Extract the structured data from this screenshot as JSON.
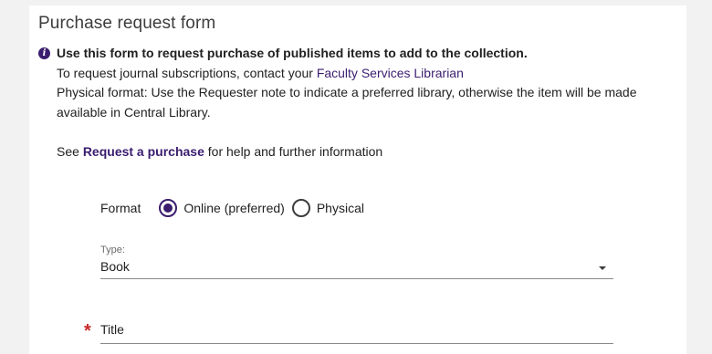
{
  "form": {
    "title": "Purchase request form"
  },
  "info": {
    "icon": "info-icon",
    "headline": "Use this form to request purchase of published items to add to the collection.",
    "journal_text": "To request journal subscriptions, contact your ",
    "journal_link": "Faculty Services Librarian",
    "physical_text": "Physical format: Use the Requester note to indicate a preferred library, otherwise the item will be made available in Central Library.",
    "see_prefix": "See ",
    "see_link": "Request a purchase",
    "see_suffix": " for help and further information"
  },
  "format": {
    "label": "Format",
    "options": [
      {
        "label": "Online (preferred)",
        "selected": true
      },
      {
        "label": "Physical",
        "selected": false
      }
    ]
  },
  "type_select": {
    "label": "Type:",
    "value": "Book"
  },
  "title_field": {
    "required_mark": "*",
    "label": "Title"
  },
  "colors": {
    "accent": "#3a1d6e",
    "required": "#c62828"
  }
}
